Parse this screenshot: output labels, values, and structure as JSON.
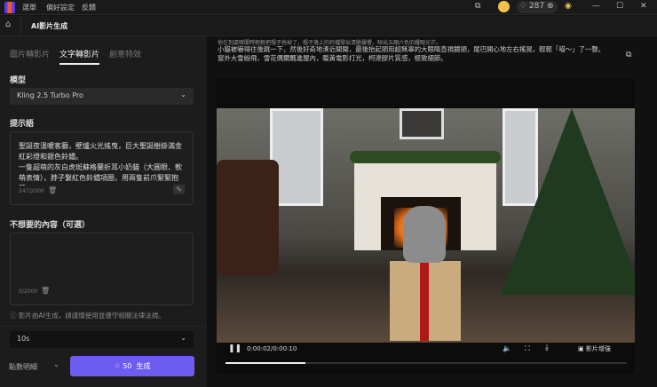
{
  "topbar": {
    "menu": [
      "選單",
      "偏好設定",
      "反饋"
    ],
    "credits": "287"
  },
  "header": {
    "title": "AI影片生成"
  },
  "tabs": [
    "圖片轉影片",
    "文字轉影片",
    "創意特效"
  ],
  "model": {
    "label": "模型",
    "value": "Kling 2.5 Turbo Pro"
  },
  "prompt": {
    "label": "提示語",
    "text": "聖誕夜溫暖客廳，壁爐火光搖曳，巨大聖誕樹掛滿金紅彩燈和銀色鈴鐺。\n一隻超萌的灰白虎斑蘇格蘭折耳小奶貓（大圓眼、軟萌表情），脖子繫紅色鈴鐺項圈，用兩隻前爪緊緊抱著一",
    "count": "247/2000"
  },
  "negative": {
    "label": "不想要的內容（可選）",
    "count": "0/2000"
  },
  "notice": "影片由AI生成，請謹慎使用並遵守相關法律法規。",
  "duration": "10s",
  "points_detail": "點數明細",
  "generate": {
    "cost": "50",
    "label": "生成"
  },
  "result": {
    "lines": [
      "他在到處嗅聞時輕輕把帽子拖掉了，帽子落上的鈴鐺發出清脆聲響，映出五顏六色的耀眼光芒。",
      "小貓被嚇得往後跳一下，然後好奇地湊近聞聞，最後抬起頭用超無辜的大眼睛直視鏡頭，尾巴開心地左右搖晃，輕輕「喵～」了一聲。",
      "窗外大雪紛飛，雪花偶爾飄進屋內，暖黃電影打光，柯達膠片質感，極致細節。"
    ]
  },
  "player": {
    "time": "0:00:02/0:00:10",
    "progress": 0.2,
    "enhance": "影片增強"
  }
}
